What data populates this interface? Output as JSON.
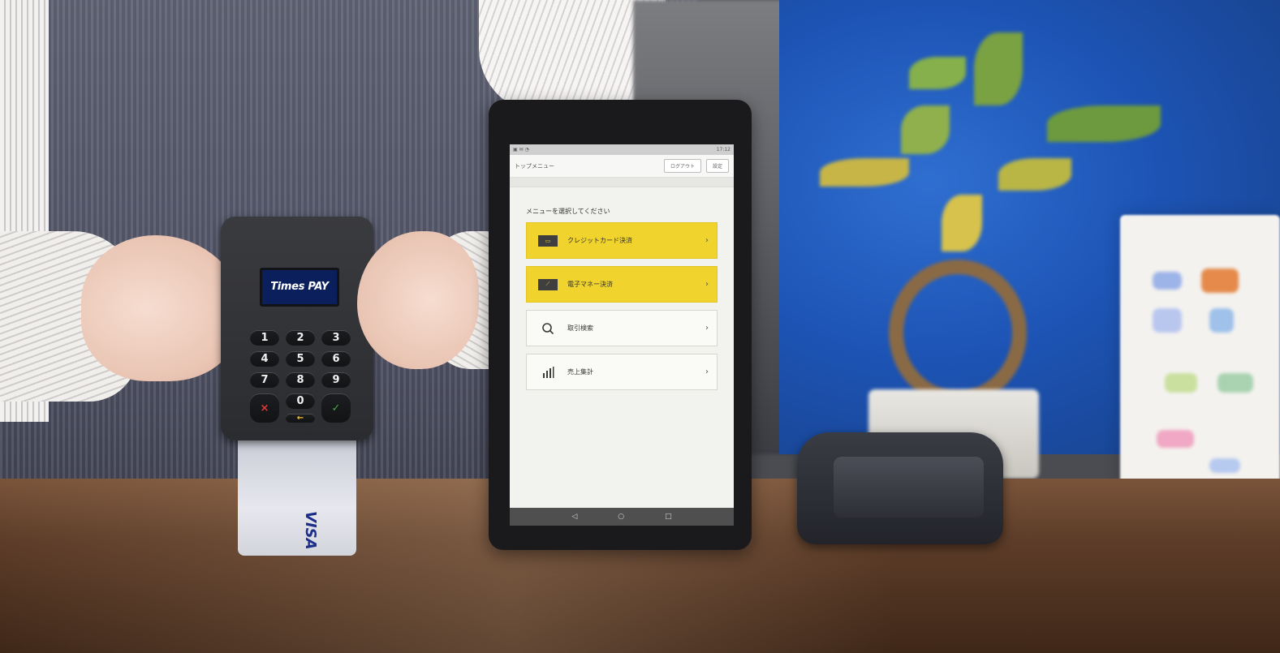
{
  "card_reader": {
    "brand": "Times PAY",
    "keys": [
      "1",
      "2",
      "3",
      "4",
      "5",
      "6",
      "7",
      "8",
      "9",
      "×",
      "0",
      "✓"
    ],
    "clear_key": "←"
  },
  "credit_card": {
    "brand": "VISA"
  },
  "tablet": {
    "status_time": "17:12",
    "app_bar": {
      "title": "トップメニュー",
      "logout_label": "ログアウト",
      "settings_label": "設定"
    },
    "prompt": "メニューを選択してください",
    "menu": [
      {
        "label": "クレジットカード決済",
        "icon": "credit-card-icon",
        "primary": true
      },
      {
        "label": "電子マネー決済",
        "icon": "e-money-icon",
        "primary": true
      },
      {
        "label": "取引検索",
        "icon": "search-icon",
        "primary": false
      },
      {
        "label": "売上集計",
        "icon": "bar-chart-icon",
        "primary": false
      }
    ],
    "nav": {
      "back": "◁",
      "home": "○",
      "recent": "□"
    }
  },
  "colors": {
    "accent_yellow": "#f0d32c",
    "reader_screen": "#0a1f5c",
    "background_blue": "#1d54b5"
  }
}
